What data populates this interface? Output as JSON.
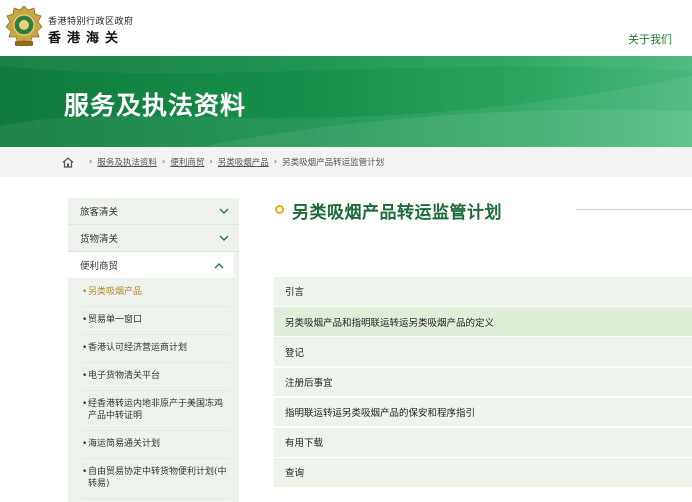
{
  "header": {
    "org_small": "香港特别行政区政府",
    "org_big": "香港海关",
    "about_link": "关于我们"
  },
  "banner": {
    "title": "服务及执法资料"
  },
  "breadcrumb": [
    "服务及执法资料",
    "便利商贸",
    "另类吸烟产品",
    "另类吸烟产品转运监管计划"
  ],
  "sidebar": {
    "items": [
      {
        "label": "旅客清关",
        "expanded": false
      },
      {
        "label": "货物清关",
        "expanded": false
      },
      {
        "label": "便利商贸",
        "expanded": true
      }
    ],
    "sub_items": [
      {
        "label": "另类吸烟产品",
        "current": true
      },
      {
        "label": "贸易单一窗口"
      },
      {
        "label": "香港认可经济营运商计划"
      },
      {
        "label": "电子货物清关平台"
      },
      {
        "label": "经香港转运内地非原产于美国冻鸡产品中转证明"
      },
      {
        "label": "海运简易通关计划"
      },
      {
        "label": "自由贸易协定中转货物便利计划(中转易)"
      }
    ]
  },
  "main": {
    "title": "另类吸烟产品转运监管计划",
    "sections": [
      {
        "label": "引言"
      },
      {
        "label": "另类吸烟产品和指明联运转运另类吸烟产品的定义",
        "highlighted": true
      },
      {
        "label": "登记"
      },
      {
        "label": "注册后事宜"
      },
      {
        "label": "指明联运转运另类吸烟产品的保安和程序指引"
      },
      {
        "label": "有用下载"
      },
      {
        "label": "查询"
      }
    ]
  },
  "colors": {
    "brand_green": "#1b6b36",
    "accent_gold": "#b8862b",
    "ring_orange": "#f0a91f"
  },
  "icons": {
    "home": "home-icon",
    "chevron_down": "chevron-down-icon",
    "chevron_up": "chevron-up-icon"
  }
}
